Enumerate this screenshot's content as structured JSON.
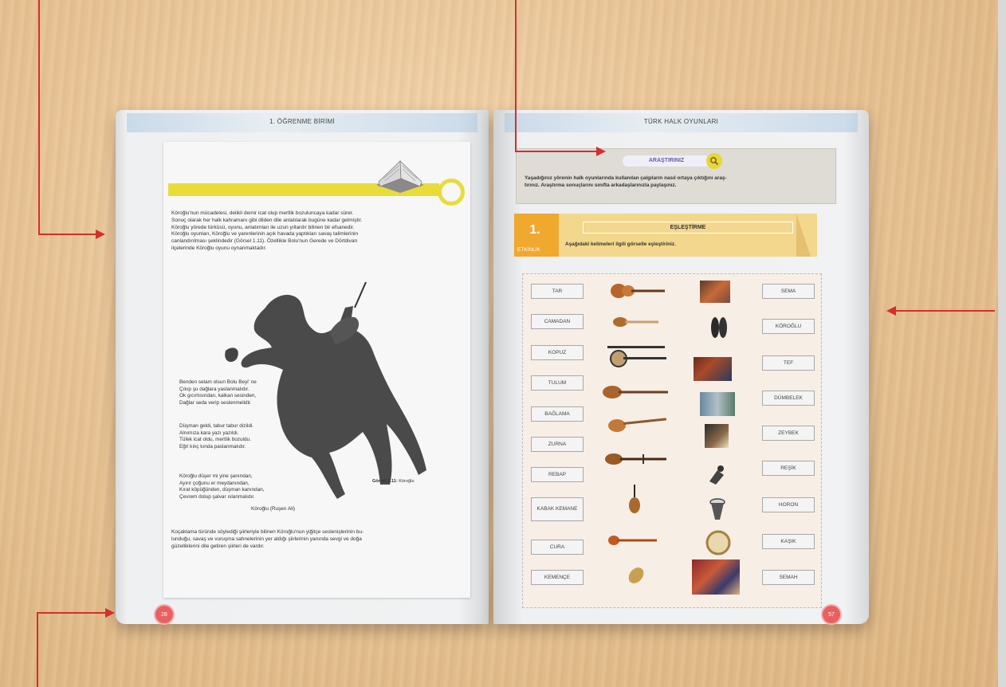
{
  "left_page": {
    "header": "1. ÖĞRENME BİRİMİ",
    "page_number": "28",
    "intro_lines": [
      "Köroğlu'nun mücadelesi, delikli demir icat olup mertlik bozuluncaya kadar sürer.",
      "Sonuç olarak her halk kahramanı gibi dilden dile anlatılarak bugüne kadar gelmiştir.",
      "Köroğlu yörede türküsü, oyunu, anlatımları ile uzun yıllardır bilinen bir efsanedir.",
      "Köroğlu oyunları, Köroğlu ve yarenlerinin açık havada yaptıkları savaş talimlerinin",
      "canlandırılması şeklindedir (Görsel 1.11). Özellikle Bolu'nun Gerede ve Dörtdivan",
      "ilçelerinde Köroğlu oyunu oynanmaktadır."
    ],
    "poem_stanzas": [
      [
        "Benden selam olsun Bolu Beyi' ne",
        "Çıkıp şu dağlara yaslanmalıdır.",
        "Ok gıcırtısından, kalkan sesinden,",
        "Dağlar seda verip seslenmelidir."
      ],
      [
        "Düşman geldi, tabur tabur dizildi.",
        "Alnımıza kara yazı yazıldı.",
        "Tüfek icat oldu, mertlik bozuldu.",
        "Eğri kılıç kında paslanmalıdır."
      ],
      [
        "Köroğlu düşer mi yine şanından,",
        "Ayırır çoğunu er meydanından,",
        "Kırat köpüğünden, düşman kanından,",
        "Çevrem dolup şalvar ıslanmalıdır."
      ]
    ],
    "poem_author": "Köroğlu (Ruşen Ali)",
    "caption_bold": "Görsel 1.11:",
    "caption_text": " Köroğlu",
    "outro_lines": [
      "Koçaklama türünde söylediği şiirleriyle bilinen Köroğlu'nun yiğitçe seslenişlerinin bu-",
      "lunduğu, savaş ve vuruşma sahnelerinin yer aldığı şiirlerinin yanında sevgi ve doğa",
      "güzelliklerini dile getiren şiirleri de vardır."
    ]
  },
  "right_page": {
    "header": "TÜRK HALK OYUNLARI",
    "page_number": "57",
    "research_label": "ARAŞTIRINIZ",
    "research_lines": [
      "Yaşadığınız yörenin halk oyunlarında kullanılan çalgıların nasıl ortaya çıktığını araş-",
      "tırınız. Araştırma sonuçlarını sınıfta arkadaşlarınızla paylaşınız."
    ],
    "activity_number": "1.",
    "activity_word": "ETKİNLİK",
    "activity_title": "EŞLEŞTİRME",
    "activity_instruction": "Aşağıdaki kelimeleri ilgili görselle eşleştiriniz.",
    "instruments": [
      "TAR",
      "CAMADAN",
      "KOPUZ",
      "TULUM",
      "BAĞLAMA",
      "ZURNA",
      "REBAP",
      "KABAK KEMANE",
      "CURA",
      "KEMENÇE"
    ],
    "dances": [
      "SEMA",
      "KÖROĞLU",
      "TEF",
      "DÜMBELEK",
      "ZEYBEK",
      "REŞİK",
      "HORON",
      "KAŞIK",
      "SEMAH"
    ]
  },
  "colors": {
    "annotation_arrow": "#d32f2f",
    "highlight_yellow": "#e8dc3a",
    "activity_orange": "#f0a82e",
    "page_badge": "#e86060"
  }
}
